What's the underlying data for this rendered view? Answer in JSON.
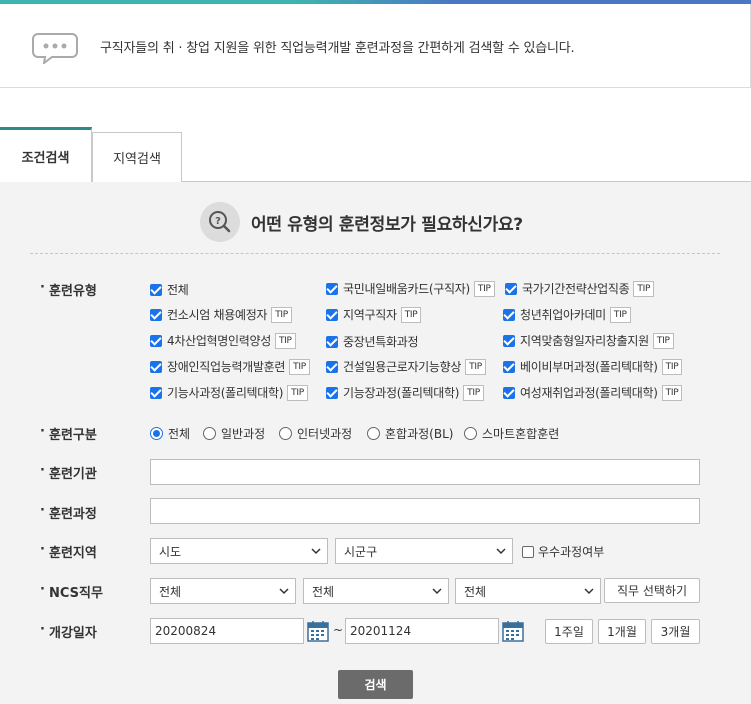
{
  "intro": {
    "message": "구직자들의 취 · 창업 지원을 위한 직업능력개발 훈련과정을 간편하게 검색할 수 있습니다."
  },
  "tabs": [
    {
      "label": "조건검색",
      "active": true
    },
    {
      "label": "지역검색",
      "active": false
    }
  ],
  "question": {
    "title": "어떤 유형의 훈련정보가 필요하신가요?"
  },
  "labels": {
    "training_type": "훈련유형",
    "training_category": "훈련구분",
    "training_institution": "훈련기관",
    "training_course": "훈련과정",
    "training_region": "훈련지역",
    "ncs_job": "NCS직무",
    "start_date": "개강일자"
  },
  "tip_label": "TIP",
  "training_types": [
    {
      "label": "전체",
      "checked": true,
      "tip": false
    },
    {
      "label": "국민내일배움카드(구직자)",
      "checked": true,
      "tip": true
    },
    {
      "label": "국가기간전략산업직종",
      "checked": true,
      "tip": true
    },
    {
      "label": "컨소시엄 채용예정자",
      "checked": true,
      "tip": true
    },
    {
      "label": "지역구직자",
      "checked": true,
      "tip": true
    },
    {
      "label": "청년취업아카데미",
      "checked": true,
      "tip": true
    },
    {
      "label": "4차산업혁명인력양성",
      "checked": true,
      "tip": true
    },
    {
      "label": "중장년특화과정",
      "checked": true,
      "tip": false
    },
    {
      "label": "지역맞춤형일자리창출지원",
      "checked": true,
      "tip": true
    },
    {
      "label": "장애인직업능력개발훈련",
      "checked": true,
      "tip": true
    },
    {
      "label": "건설일용근로자기능향상",
      "checked": true,
      "tip": true
    },
    {
      "label": "베이비부머과정(폴리텍대학)",
      "checked": true,
      "tip": true
    },
    {
      "label": "기능사과정(폴리텍대학)",
      "checked": true,
      "tip": true
    },
    {
      "label": "기능장과정(폴리텍대학)",
      "checked": true,
      "tip": true
    },
    {
      "label": "여성재취업과정(폴리텍대학)",
      "checked": true,
      "tip": true
    }
  ],
  "training_categories": [
    {
      "label": "전체",
      "selected": true
    },
    {
      "label": "일반과정",
      "selected": false
    },
    {
      "label": "인터넷과정",
      "selected": false
    },
    {
      "label": "혼합과정(BL)",
      "selected": false
    },
    {
      "label": "스마트혼합훈련",
      "selected": false
    }
  ],
  "inputs": {
    "institution_value": "",
    "course_value": ""
  },
  "region": {
    "sido": "시도",
    "sigungu": "시군구",
    "excellent_label": "우수과정여부"
  },
  "ncs": {
    "select1": "전체",
    "select2": "전체",
    "select3": "전체",
    "select_job_button": "직무 선택하기"
  },
  "dates": {
    "from": "20200824",
    "separator": "~",
    "to": "20201124",
    "week1": "1주일",
    "month1": "1개월",
    "month3": "3개월"
  },
  "search_button": "검색",
  "colors": {
    "accent_teal": "#2d8a86",
    "checkbox_blue": "#1a73e8",
    "search_button": "#6b6b6b"
  }
}
